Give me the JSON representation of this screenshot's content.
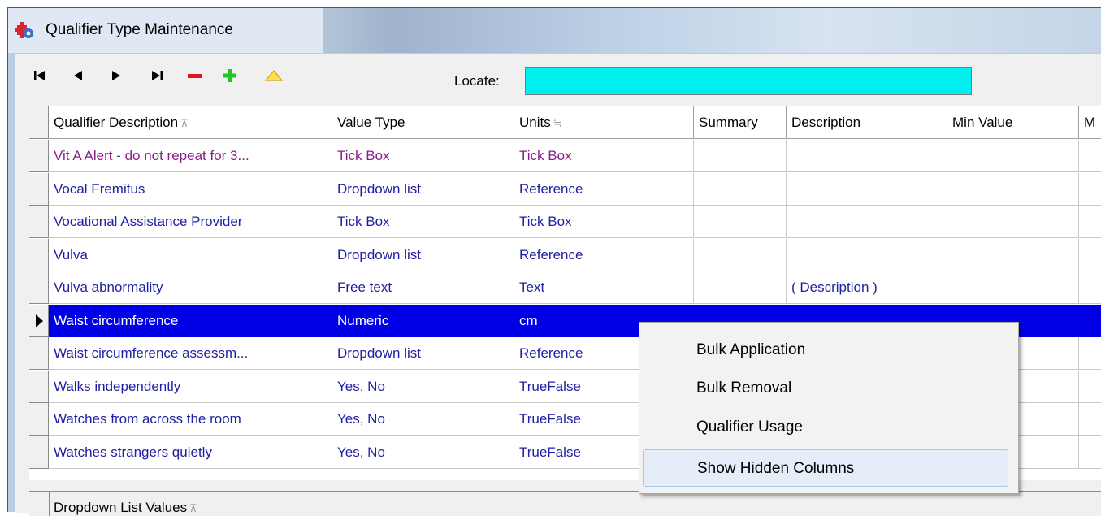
{
  "window": {
    "title": "Qualifier Type Maintenance"
  },
  "toolbar": {
    "buttons": [
      {
        "name": "first-record-icon",
        "glyph": "|◀"
      },
      {
        "name": "previous-record-icon",
        "glyph": "◀"
      },
      {
        "name": "next-record-icon",
        "glyph": "▶"
      },
      {
        "name": "last-record-icon",
        "glyph": "▶|"
      },
      {
        "name": "delete-record-icon",
        "glyph": "−"
      },
      {
        "name": "add-record-icon",
        "glyph": "+"
      },
      {
        "name": "edit-record-icon",
        "glyph": "△"
      }
    ],
    "locate_label": "Locate:",
    "locate_value": ""
  },
  "grid": {
    "columns": [
      "Qualifier Description",
      "Value Type",
      "Units",
      "Summary",
      "Description",
      "Min Value",
      "M"
    ],
    "rows": [
      [
        "Vit A Alert - do not repeat for 3...",
        "Tick Box",
        "Tick Box",
        "",
        "",
        ""
      ],
      [
        "Vocal Fremitus",
        "Dropdown list",
        "Reference",
        "",
        "",
        ""
      ],
      [
        "Vocational Assistance Provider",
        "Tick Box",
        "Tick Box",
        "",
        "",
        ""
      ],
      [
        "Vulva",
        "Dropdown list",
        "Reference",
        "",
        "",
        ""
      ],
      [
        "Vulva abnormality",
        "Free text",
        "Text",
        "",
        "( Description )",
        ""
      ],
      [
        "Waist circumference",
        "Numeric",
        "cm",
        "",
        "",
        ""
      ],
      [
        "Waist circumference assessm...",
        "Dropdown list",
        "Reference",
        "",
        "",
        ""
      ],
      [
        "Walks independently",
        "Yes, No",
        "TrueFalse",
        "",
        "",
        ""
      ],
      [
        "Watches from across the room",
        "Yes, No",
        "TrueFalse",
        "",
        "",
        ""
      ],
      [
        "Watches strangers quietly",
        "Yes, No",
        "TrueFalse",
        "",
        "",
        ""
      ]
    ]
  },
  "bottom_panel": {
    "label": "Dropdown List Values"
  },
  "context_menu": {
    "items": [
      "Bulk Application",
      "Bulk Removal",
      "Qualifier Usage",
      "Show Hidden Columns"
    ]
  },
  "colors": {
    "selection": "#0000e6",
    "locate_bg": "#00f0f0",
    "row_text": "#1f1fa3",
    "first_row_text": "#8a1f8a"
  }
}
